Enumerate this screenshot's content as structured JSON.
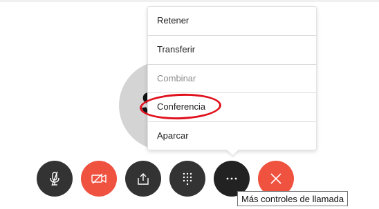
{
  "menu": {
    "items": [
      {
        "label": "Retener",
        "enabled": true
      },
      {
        "label": "Transferir",
        "enabled": true
      },
      {
        "label": "Combinar",
        "enabled": false
      },
      {
        "label": "Conferencia",
        "enabled": true,
        "highlighted": true
      },
      {
        "label": "Aparcar",
        "enabled": true
      }
    ]
  },
  "controls": [
    {
      "name": "mute",
      "icon": "microphone-muted-icon",
      "color": "#333333"
    },
    {
      "name": "video",
      "icon": "video-off-icon",
      "color": "#f05240"
    },
    {
      "name": "share",
      "icon": "share-screen-icon",
      "color": "#333333"
    },
    {
      "name": "keypad",
      "icon": "keypad-icon",
      "color": "#333333"
    },
    {
      "name": "more",
      "icon": "more-options-icon",
      "color": "#333333"
    },
    {
      "name": "end-call",
      "icon": "close-icon",
      "color": "#f05240"
    }
  ],
  "tooltip": {
    "text": "Más controles de llamada"
  },
  "avatar": {
    "initials": "S"
  },
  "highlight_color": "#e0101c"
}
